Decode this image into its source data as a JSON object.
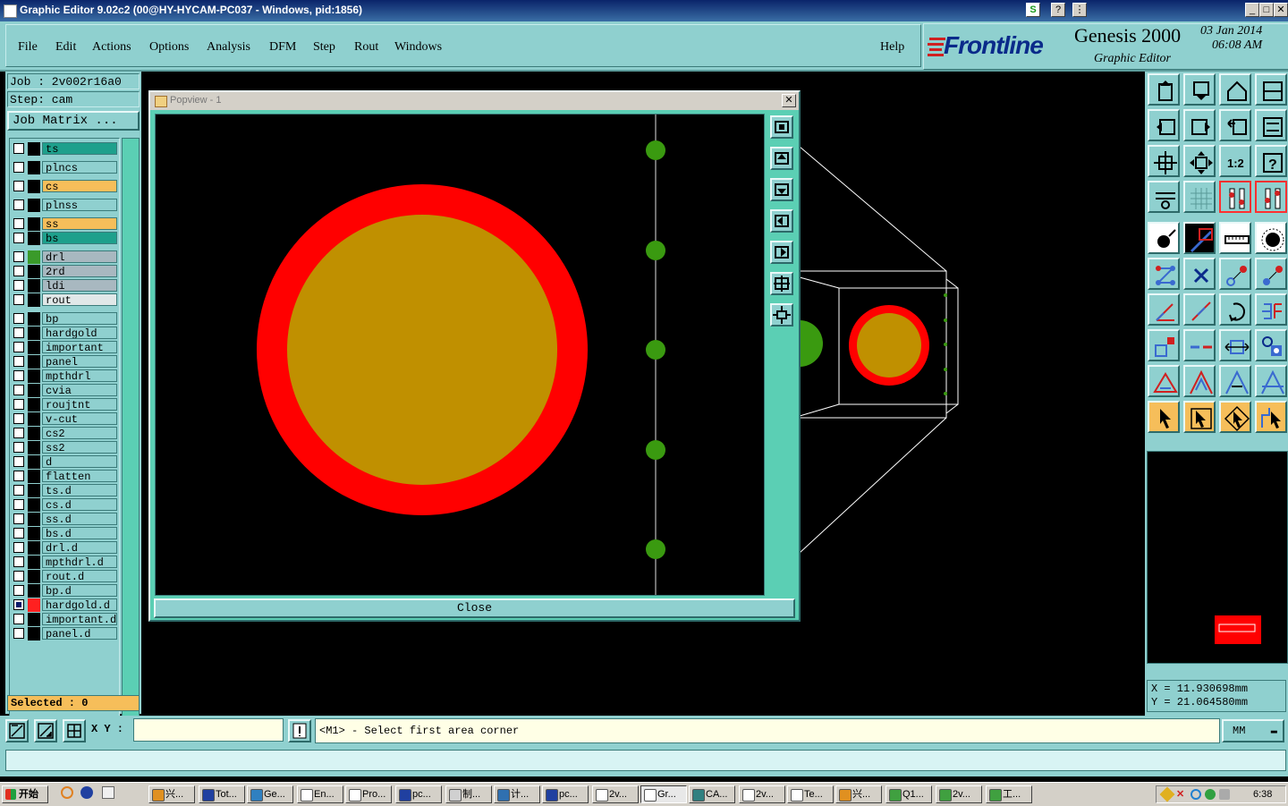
{
  "window": {
    "title": "Graphic Editor 9.02c2 (00@HY-HYCAM-PC037 - Windows, pid:1856)"
  },
  "menu": {
    "items": [
      "File",
      "Edit",
      "Actions",
      "Options",
      "Analysis",
      "DFM",
      "Step",
      "Rout",
      "Windows"
    ],
    "help": "Help"
  },
  "brand": {
    "logo": "Frontline",
    "product": "Genesis 2000",
    "subtitle": "Graphic Editor",
    "date": "03 Jan 2014",
    "time": "06:08 AM"
  },
  "job": {
    "job_line": "Job : 2v002r16a0",
    "step_line": "Step: cam",
    "matrix_button": "Job Matrix ..."
  },
  "layers": [
    {
      "name": "ts",
      "color": "#1ea08c",
      "swatch": "#000000"
    },
    {
      "name": "plncs",
      "color": "#8fd0cf",
      "swatch": "#000000"
    },
    {
      "name": "cs",
      "color": "#f6be5a",
      "swatch": "#000000"
    },
    {
      "name": "plnss",
      "color": "#8fd0cf",
      "swatch": "#000000"
    },
    {
      "name": "ss",
      "color": "#f6be5a",
      "swatch": "#000000"
    },
    {
      "name": "bs",
      "color": "#1ea08c",
      "swatch": "#000000"
    },
    {
      "name": "drl",
      "color": "#a8b8c0",
      "swatch": "#3a9a2a"
    },
    {
      "name": "2rd",
      "color": "#a8b8c0",
      "swatch": "#000000"
    },
    {
      "name": "ldi",
      "color": "#a8b8c0",
      "swatch": "#000000"
    },
    {
      "name": "rout",
      "color": "#e0e8e8",
      "swatch": "#000000"
    },
    {
      "name": "bp",
      "color": "#8fd0cf",
      "swatch": "#000000"
    },
    {
      "name": "hardgold",
      "color": "#8fd0cf",
      "swatch": "#000000"
    },
    {
      "name": "important",
      "color": "#8fd0cf",
      "swatch": "#000000"
    },
    {
      "name": "panel",
      "color": "#8fd0cf",
      "swatch": "#000000"
    },
    {
      "name": "mpthdrl",
      "color": "#8fd0cf",
      "swatch": "#000000"
    },
    {
      "name": "cvia",
      "color": "#8fd0cf",
      "swatch": "#000000"
    },
    {
      "name": "roujtnt",
      "color": "#8fd0cf",
      "swatch": "#000000"
    },
    {
      "name": "v-cut",
      "color": "#8fd0cf",
      "swatch": "#000000"
    },
    {
      "name": "cs2",
      "color": "#8fd0cf",
      "swatch": "#000000"
    },
    {
      "name": "ss2",
      "color": "#8fd0cf",
      "swatch": "#000000"
    },
    {
      "name": "d",
      "color": "#8fd0cf",
      "swatch": "#000000"
    },
    {
      "name": "flatten",
      "color": "#8fd0cf",
      "swatch": "#000000"
    },
    {
      "name": "ts.d",
      "color": "#8fd0cf",
      "swatch": "#000000"
    },
    {
      "name": "cs.d",
      "color": "#8fd0cf",
      "swatch": "#000000"
    },
    {
      "name": "ss.d",
      "color": "#8fd0cf",
      "swatch": "#000000"
    },
    {
      "name": "bs.d",
      "color": "#8fd0cf",
      "swatch": "#000000"
    },
    {
      "name": "drl.d",
      "color": "#8fd0cf",
      "swatch": "#000000"
    },
    {
      "name": "mpthdrl.d",
      "color": "#8fd0cf",
      "swatch": "#000000"
    },
    {
      "name": "rout.d",
      "color": "#8fd0cf",
      "swatch": "#000000"
    },
    {
      "name": "bp.d",
      "color": "#8fd0cf",
      "swatch": "#000000"
    },
    {
      "name": "hardgold.d",
      "color": "#8fd0cf",
      "swatch": "#ff2020",
      "checked": true
    },
    {
      "name": "important.d",
      "color": "#8fd0cf",
      "swatch": "#000000"
    },
    {
      "name": "panel.d",
      "color": "#8fd0cf",
      "swatch": "#000000"
    }
  ],
  "selected": "Selected : 0",
  "popview": {
    "title": "Popview - 1",
    "close_label": "Close"
  },
  "coords": {
    "x": "X  =  11.930698mm",
    "y": "Y  =  21.064580mm"
  },
  "command": {
    "xy_label": "X Y :",
    "input_value": "",
    "prompt": "<M1> - Select first area corner",
    "units": "MM"
  },
  "taskbar": {
    "start": "开始",
    "items": [
      "兴...",
      "Tot...",
      "Ge...",
      "En...",
      "Pro...",
      "pc...",
      "制...",
      "计...",
      "pc...",
      "2v...",
      "Gr...",
      "CA...",
      "2v...",
      "Te...",
      "兴...",
      "Q1...",
      "2v...",
      "工..."
    ],
    "active_index": 10,
    "clock": "6:38"
  },
  "colors": {
    "panel": "#8fd0cf",
    "accent": "#5bcfb4",
    "pad_ring": "#ff0000",
    "pad_fill": "#c09000",
    "drill": "#3a9a10"
  }
}
